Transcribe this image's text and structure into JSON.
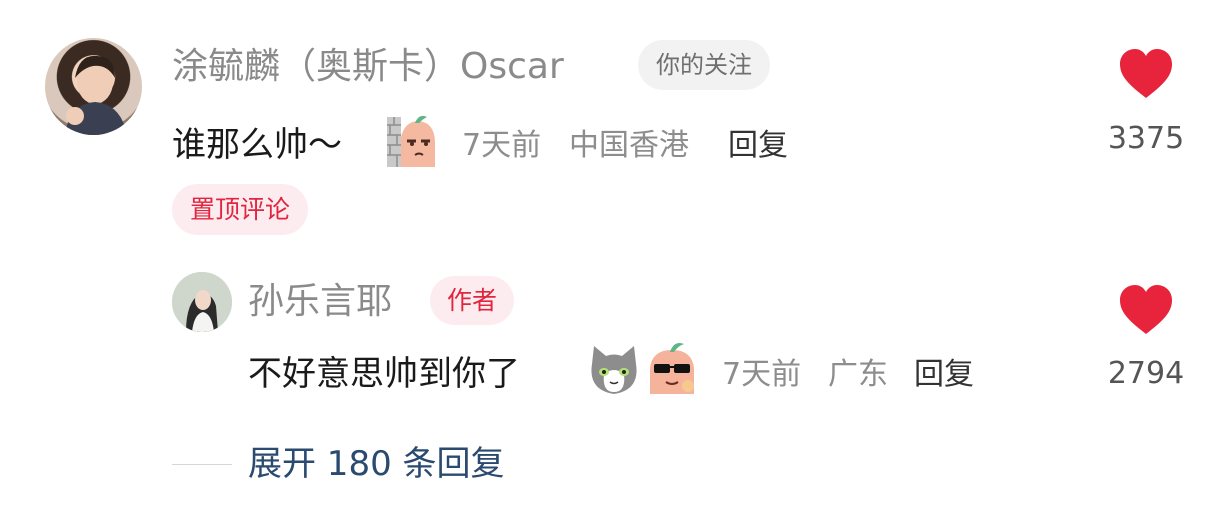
{
  "comment": {
    "author": "涂毓麟（奥斯卡）Oscar",
    "follow_tag": "你的关注",
    "text": "谁那么帅～",
    "time": "7天前",
    "location": "中国香港",
    "reply_label": "回复",
    "likes": "3375",
    "pinned_tag": "置顶评论"
  },
  "reply": {
    "author": "孙乐言耶",
    "author_tag": "作者",
    "text": "不好意思帅到你了",
    "time": "7天前",
    "location": "广东",
    "reply_label": "回复",
    "likes": "2794"
  },
  "expand_label": "展开 180 条回复",
  "colors": {
    "like": "#e8233c",
    "expand_text": "#2a4a6f",
    "tag_red": "#e1253f"
  },
  "icons": [
    "heart-icon",
    "peek-emoji-icon",
    "cat-emoji-icon",
    "cool-sunglasses-emoji-icon"
  ]
}
